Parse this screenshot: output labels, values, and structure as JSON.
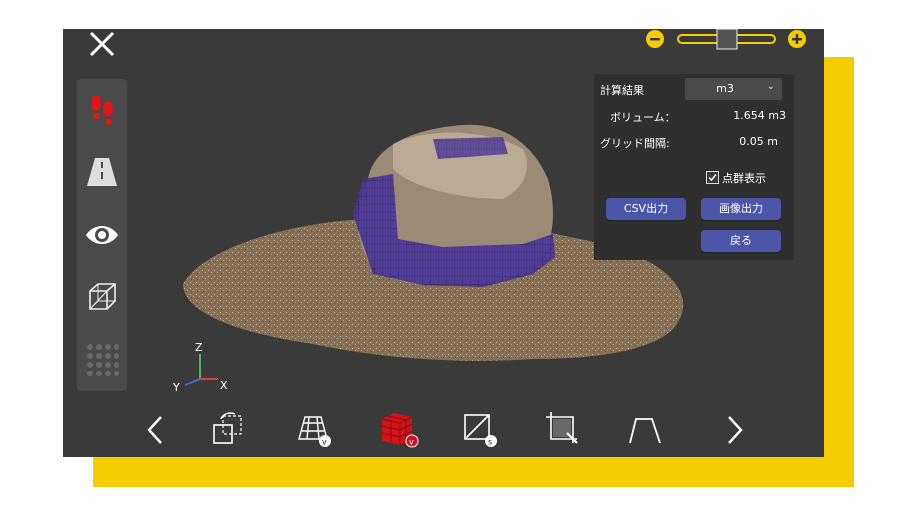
{
  "panel": {
    "result_label": "計算結果",
    "unit_selected": "m3",
    "volume_label": "ボリューム：",
    "volume_value": "1.654 m3",
    "grid_label": "グリッド間隔:",
    "grid_value": "0.05 m",
    "pointcloud_label": "点群表示",
    "pointcloud_checked": true,
    "csv_button": "CSV出力",
    "image_button": "画像出力",
    "back_button": "戻る"
  },
  "axes": {
    "x": "X",
    "y": "Y",
    "z": "Z"
  },
  "zoom_level": 0.45,
  "colors": {
    "accent_yellow": "#f5cc00",
    "button_blue": "#4c55a8",
    "active_red": "#d0141a",
    "app_bg": "#3a3a3a"
  },
  "left_tools": [
    "footprints-icon",
    "road-icon",
    "eye-icon",
    "wireframe-cube-icon",
    "dot-grid-icon"
  ],
  "bottom_tools": [
    "prev-arrow-icon",
    "transform-icon",
    "volume-plane-icon",
    "volume-voxel-icon",
    "section-s-icon",
    "crop-icon",
    "profile-icon",
    "next-arrow-icon"
  ]
}
